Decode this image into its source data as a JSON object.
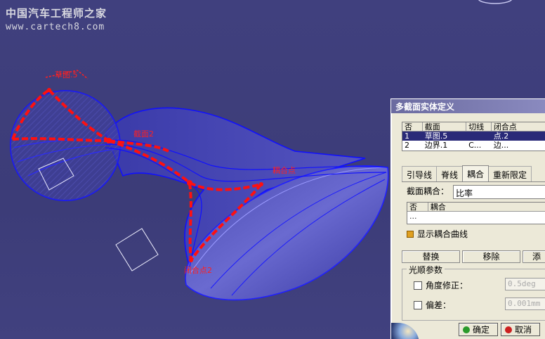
{
  "watermark": {
    "title": "中国汽车工程师之家",
    "url": "www.cartech8.com"
  },
  "viewport_labels": {
    "section1": "草图.5",
    "section2": "截面2",
    "coupling_label": "耦合点",
    "closing_label": "闭合点2"
  },
  "dialog": {
    "title": "多截面实体定义",
    "sections_table": {
      "headers": [
        "否",
        "截面",
        "切线",
        "闭合点"
      ],
      "rows": [
        [
          "1",
          "草图.5",
          "",
          "点.2"
        ],
        [
          "2",
          "边界.1",
          "C...",
          "边..."
        ]
      ]
    },
    "tabs": [
      "引导线",
      "脊线",
      "耦合",
      "重新限定"
    ],
    "active_tab": "耦合",
    "coupling": {
      "label": "截面耦合：",
      "value": "比率",
      "table_headers": [
        "否",
        "耦合"
      ],
      "table_placeholder": "...",
      "show_curves_label": "显示耦合曲线"
    },
    "buttons": {
      "replace": "替换",
      "remove": "移除",
      "add": "添"
    },
    "smooth_group": {
      "label": "光顺参数",
      "angle_label": "角度修正：",
      "angle_value": "0.5deg",
      "deviation_label": "偏差：",
      "deviation_value": "0.001mm"
    },
    "ok_label": "确定",
    "cancel_label": "取消"
  },
  "colors": {
    "background": "#3f3f7a",
    "surface_edge": "#0000ff",
    "guide_red": "#ff1010",
    "ok_green": "#2a9a2a",
    "cancel_red": "#cc2020"
  }
}
